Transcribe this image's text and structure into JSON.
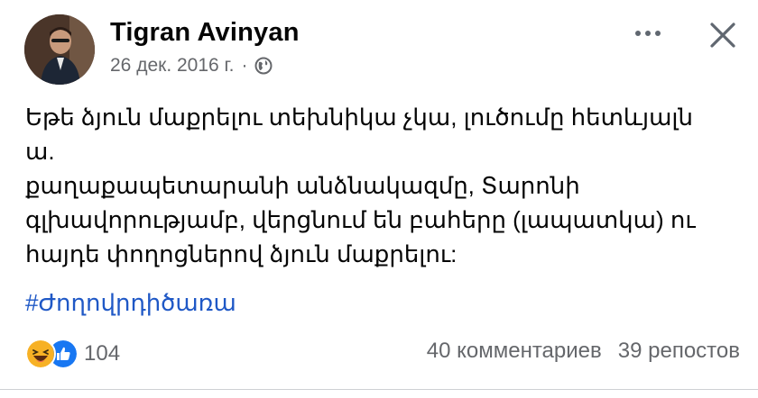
{
  "post": {
    "author": "Tigran Avinyan",
    "date": "26 дек. 2016 г.",
    "separator": "·",
    "privacy_icon": "globe-icon",
    "body_lines": [
      "Եթե ձյուն մաքրելու տեխնիկա չկա, լուծումը հետևյալն",
      "ա.",
      "քաղաքապետարանի անձնակազմը, Տարոնի",
      "գլխավորությամբ, վերցնում են բահերը (լապատկա) ու",
      "հայդե փողոցներով ձյուն մաքրելու:"
    ],
    "hashtag": "#Ժողովրդիծառա",
    "reaction_count": "104",
    "comments": "40 комментариев",
    "shares": "39 репостов",
    "colors": {
      "hashtag": "#1f58c6",
      "secondary_text": "#65676b",
      "like_blue": "#1877f2",
      "haha_yellow": "#f7b125"
    }
  }
}
